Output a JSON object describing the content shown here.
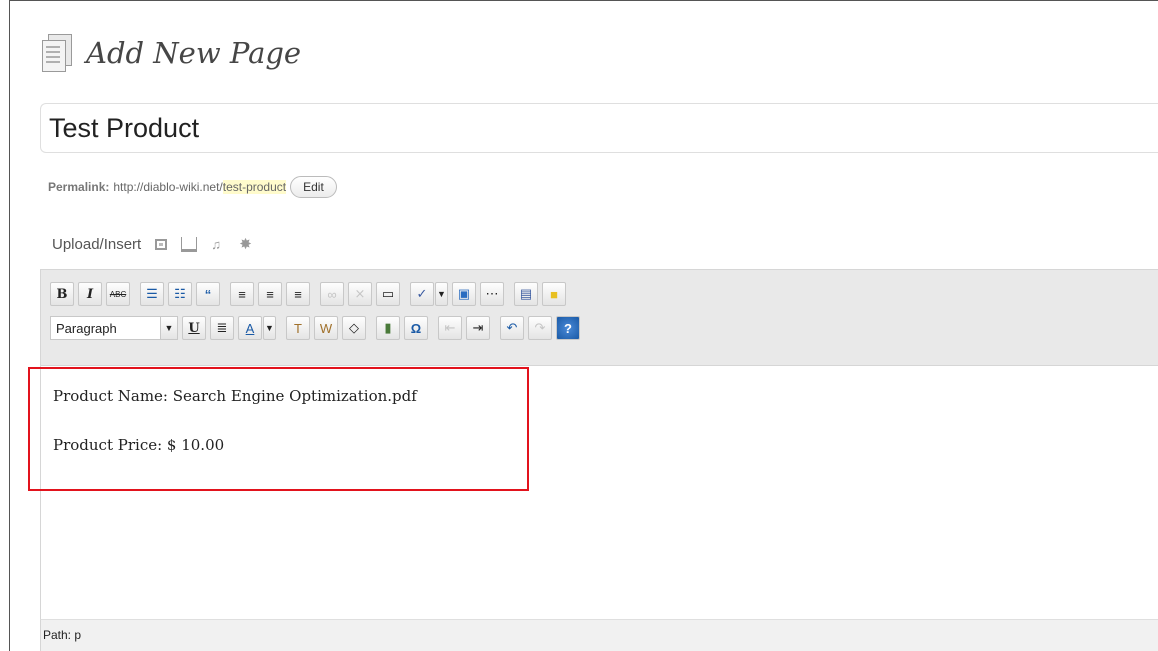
{
  "page": {
    "title": "Add New Page"
  },
  "post_title": {
    "value": "Test Product"
  },
  "permalink": {
    "label": "Permalink:",
    "base_url": "http://diablo-wiki.net/",
    "slug": "test-product",
    "edit_label": "Edit"
  },
  "upload": {
    "label": "Upload/Insert",
    "icons": [
      "image-icon",
      "video-icon",
      "audio-icon",
      "media-icon"
    ]
  },
  "toolbar": {
    "row1": [
      {
        "name": "bold-button",
        "glyph": "B"
      },
      {
        "name": "italic-button",
        "glyph": "I"
      },
      {
        "name": "strikethrough-button",
        "glyph": "ABC"
      },
      {
        "name": "bullet-list-button",
        "glyph": "☰"
      },
      {
        "name": "numbered-list-button",
        "glyph": "☷"
      },
      {
        "name": "blockquote-button",
        "glyph": "66"
      },
      {
        "name": "align-left-button",
        "glyph": "≡"
      },
      {
        "name": "align-center-button",
        "glyph": "≡"
      },
      {
        "name": "align-right-button",
        "glyph": "≡"
      },
      {
        "name": "insert-link-button",
        "glyph": "∞"
      },
      {
        "name": "unlink-button",
        "glyph": "⨯"
      },
      {
        "name": "more-tag-button",
        "glyph": "▭"
      },
      {
        "name": "spellcheck-button",
        "glyph": "✓"
      },
      {
        "name": "fullscreen-button",
        "glyph": "▣"
      },
      {
        "name": "kitchen-sink-button",
        "glyph": "⋯"
      },
      {
        "name": "paste-button",
        "glyph": "▤"
      },
      {
        "name": "note-button",
        "glyph": "▨"
      }
    ],
    "row2": {
      "format_select": "Paragraph",
      "buttons": [
        {
          "name": "underline-button",
          "glyph": "U"
        },
        {
          "name": "justify-button",
          "glyph": "≣"
        },
        {
          "name": "text-color-button",
          "glyph": "A"
        },
        {
          "name": "paste-text-button",
          "glyph": "T"
        },
        {
          "name": "paste-word-button",
          "glyph": "W"
        },
        {
          "name": "remove-format-button",
          "glyph": "◇"
        },
        {
          "name": "insert-media-button",
          "glyph": "▮"
        },
        {
          "name": "special-char-button",
          "glyph": "Ω"
        },
        {
          "name": "outdent-button",
          "glyph": "⇤"
        },
        {
          "name": "indent-button",
          "glyph": "⇥"
        },
        {
          "name": "undo-button",
          "glyph": "↶"
        },
        {
          "name": "redo-button",
          "glyph": "↷"
        },
        {
          "name": "help-button",
          "glyph": "?"
        }
      ]
    }
  },
  "content": {
    "line1": "Product Name:  Search Engine Optimization.pdf",
    "line2": "Product Price: $ 10.00"
  },
  "statusbar": {
    "path": "Path: p"
  },
  "colors": {
    "highlight_border": "#e2131d",
    "slug_highlight": "#fffbcc"
  }
}
